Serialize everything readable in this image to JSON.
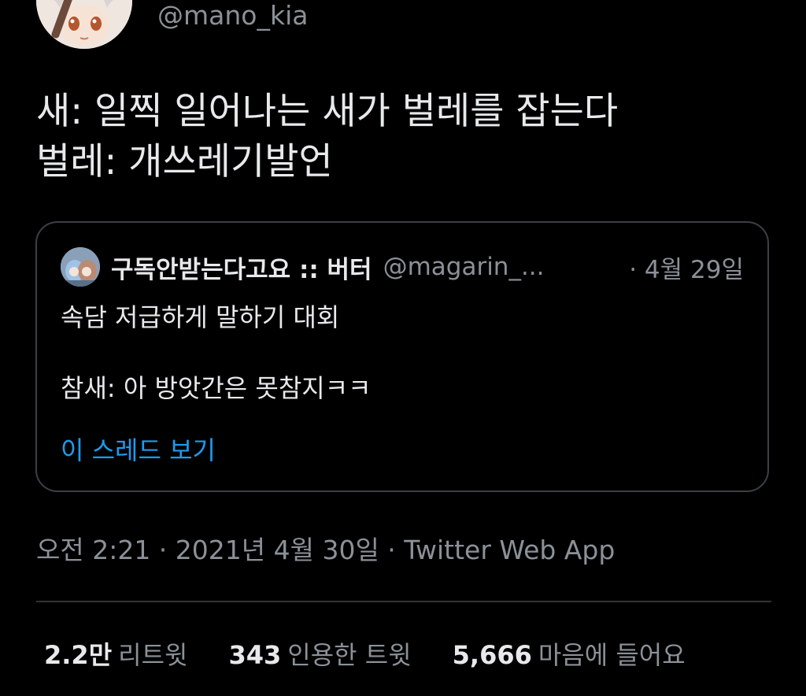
{
  "author": {
    "handle": "@mano_kia"
  },
  "tweet": {
    "lines": [
      "새: 일찍 일어나는 새가 벌레를 잡는다",
      "벌레: 개쓰레기발언"
    ]
  },
  "quoted": {
    "name": "구독안받는다고요 :: 버터",
    "handle": "@magarin_...",
    "date": "· 4월 29일",
    "body_line1": "속담 저급하게 말하기 대회",
    "body_line2": "참새: 아 방앗간은 못참지ㅋㅋ",
    "show_thread": "이 스레드 보기"
  },
  "meta": "오전 2:21 · 2021년 4월 30일 · Twitter Web App",
  "stats": {
    "retweets_count": "2.2만",
    "retweets_label": "리트윗",
    "quotes_count": "343",
    "quotes_label": "인용한 트윗",
    "likes_count": "5,666",
    "likes_label": "마음에 들어요"
  },
  "colors": {
    "background": "#000000",
    "text": "#e7e9ea",
    "secondary": "#8b9198",
    "link": "#1d9bf0",
    "border": "#3b4046"
  },
  "icons": {
    "author_avatar": "anime-character-avatar",
    "quoted_avatar": "anime-characters-avatar"
  }
}
